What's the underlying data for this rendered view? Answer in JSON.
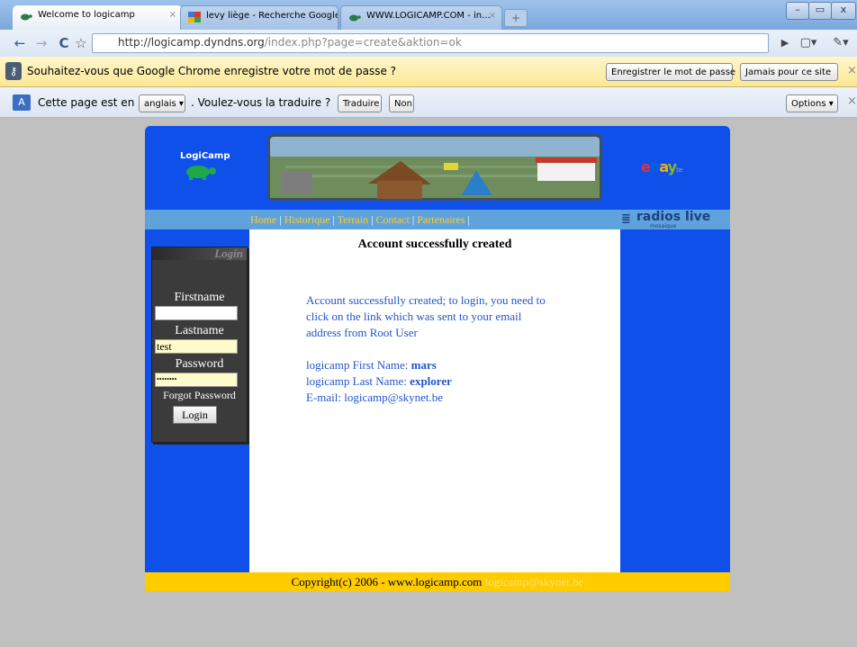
{
  "browser": {
    "tabs": [
      {
        "title": "Welcome to logicamp"
      },
      {
        "title": "levy liège - Recherche Google"
      },
      {
        "title": "WWW.LOGICAMP.COM - in..."
      }
    ],
    "new_tab": "+",
    "url_host": "http://logicamp.dyndns.org",
    "url_path": "/index.php?page=create&aktion=ok",
    "window": {
      "minimize": "–",
      "maximize": "▭",
      "close": "x"
    }
  },
  "password_bar": {
    "message": "Souhaitez-vous que Google Chrome enregistre votre mot de passe ?",
    "save_button": "Enregistrer le mot de passe",
    "never_button": "Jamais pour ce site",
    "close": "×"
  },
  "translate_bar": {
    "prefix": "Cette page est en",
    "language": "anglais",
    "question": ". Voulez-vous la traduire ?",
    "translate_button": "Traduire",
    "no_button": "Non",
    "options_button": "Options",
    "close": "×"
  },
  "site": {
    "logo_text": "LogiCamp",
    "ebay_suffix": "be",
    "nav": [
      "Home",
      "Historique",
      "Terrain",
      "Contact",
      "Partenaires"
    ],
    "nav_separator": "|",
    "radios_live": "radios live",
    "radios_sub": "mosaique",
    "login": {
      "header": "Login",
      "firstname_label": "Firstname",
      "firstname_value": "",
      "lastname_label": "Lastname",
      "lastname_value": "test",
      "password_label": "Password",
      "password_value": "••••••••",
      "forgot": "Forgot Password",
      "button": "Login"
    },
    "content": {
      "heading": "Account successfully created",
      "message_line1": "Account successfully created; to login, you need to",
      "message_line2": "click on the link which was sent to your email",
      "message_line3": "address from Root User",
      "first_name_label": "logicamp First Name:",
      "first_name_value": "mars",
      "last_name_label": "logicamp Last Name:",
      "last_name_value": "explorer",
      "email_line": "E-mail: logicamp@skynet.be"
    },
    "footer_text": "Copyright(c) 2006 - www.logicamp.com",
    "footer_email": "logicamp@skynet.be"
  },
  "colors": {
    "site_blue": "#0f50ea",
    "nav_blue": "#5fa3dc",
    "nav_link": "#ffcc33",
    "footer_yellow": "#ffcc00",
    "content_text": "#2255cc"
  }
}
